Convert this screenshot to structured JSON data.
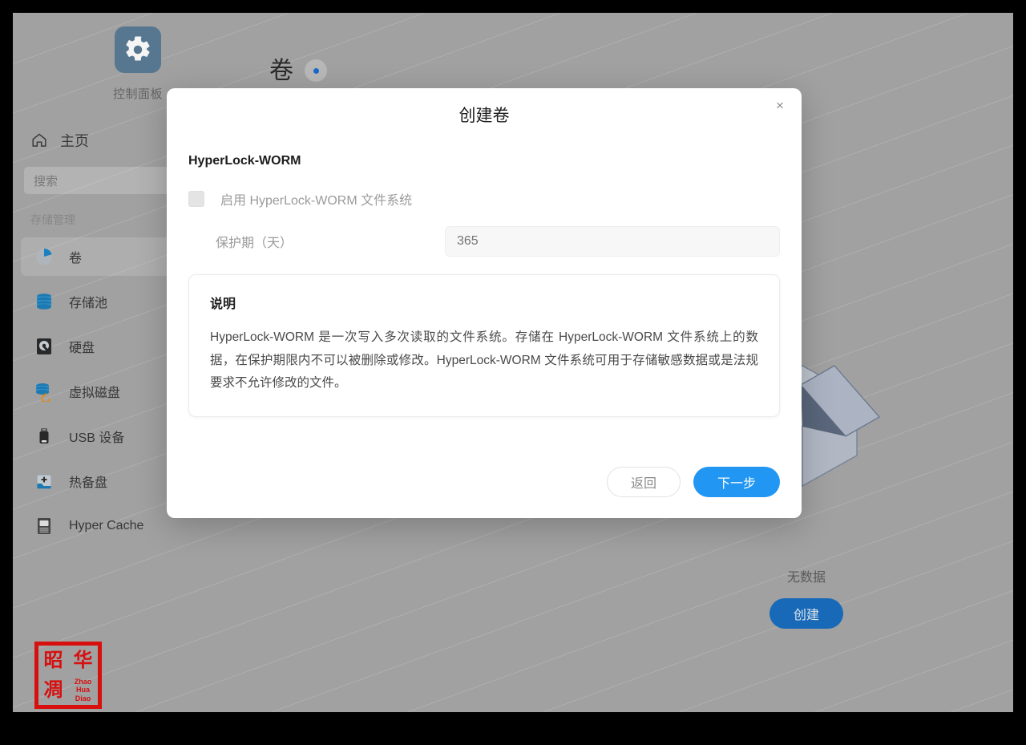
{
  "app": {
    "control_panel": {
      "label": "控制面板",
      "icon": "gear-icon"
    },
    "page_title": "卷"
  },
  "sidebar": {
    "home": {
      "label": "主页",
      "icon": "home-icon"
    },
    "search": {
      "placeholder": "搜索",
      "icon": "search-icon"
    },
    "section_label": "存储管理",
    "items": [
      {
        "label": "卷",
        "icon": "volume-pie-icon",
        "selected": true
      },
      {
        "label": "存储池",
        "icon": "storage-pool-icon",
        "selected": false
      },
      {
        "label": "硬盘",
        "icon": "hard-disk-icon",
        "selected": false
      },
      {
        "label": "虚拟磁盘",
        "icon": "virtual-disk-icon",
        "selected": false
      },
      {
        "label": "USB 设备",
        "icon": "usb-device-icon",
        "selected": false
      },
      {
        "label": "热备盘",
        "icon": "hot-spare-icon",
        "selected": false
      },
      {
        "label": "Hyper Cache",
        "icon": "ssd-cache-icon",
        "selected": false
      }
    ]
  },
  "empty_state": {
    "text": "无数据",
    "create_label": "创建"
  },
  "seal": {
    "char_tl": "昭",
    "char_tr": "华",
    "char_bl": "凋",
    "pinyin_1": "Zhao",
    "pinyin_2": "Hua",
    "pinyin_3": "Diao"
  },
  "dialog": {
    "title": "创建卷",
    "close_icon": "close-icon",
    "section_heading": "HyperLock-WORM",
    "checkbox_label": "启用 HyperLock-WORM 文件系统",
    "checkbox_checked": false,
    "period_label": "保护期（天）",
    "period_placeholder": "365",
    "period_value": "",
    "info_title": "说明",
    "info_body": "HyperLock-WORM 是一次写入多次读取的文件系统。存储在 HyperLock-WORM 文件系统上的数据，在保护期限内不可以被删除或修改。HyperLock-WORM 文件系统可用于存储敏感数据或是法规要求不允许修改的文件。",
    "back_label": "返回",
    "next_label": "下一步"
  },
  "colors": {
    "accent_blue": "#2196f3",
    "create_blue": "#1a6fc0",
    "desktop_grey": "#a8a8a8",
    "seal_red": "#e01010",
    "gear_tile": "#5b7c96"
  }
}
